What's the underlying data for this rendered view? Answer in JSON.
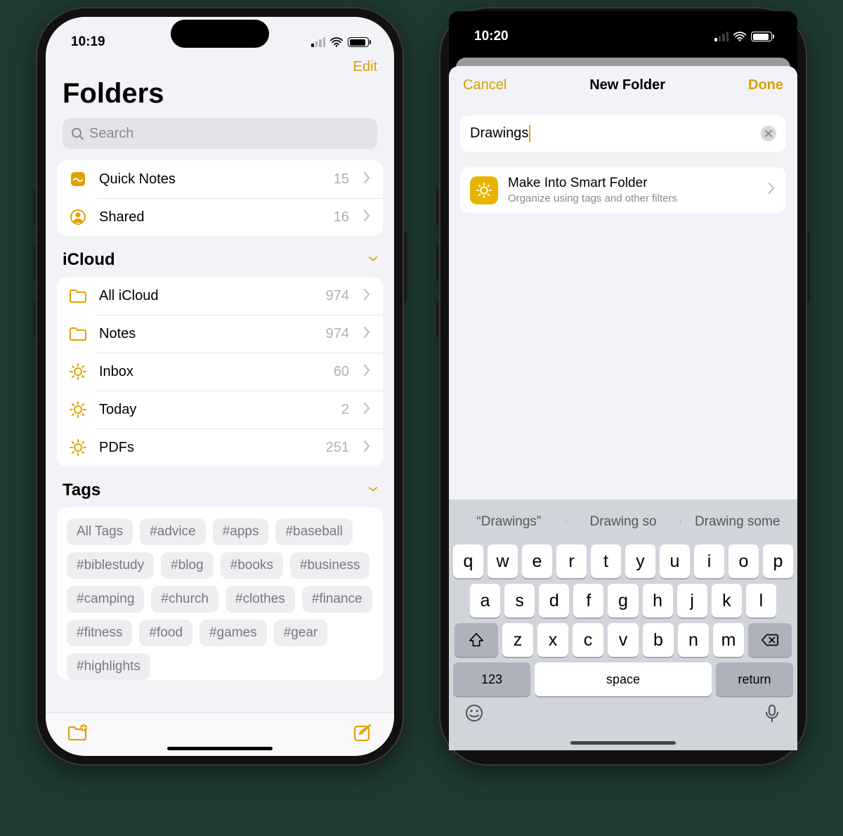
{
  "left": {
    "status": {
      "time": "10:19"
    },
    "nav": {
      "edit": "Edit",
      "title": "Folders"
    },
    "search": {
      "placeholder": "Search"
    },
    "top_group": [
      {
        "icon": "quicknote",
        "label": "Quick Notes",
        "count": "15"
      },
      {
        "icon": "shared",
        "label": "Shared",
        "count": "16"
      }
    ],
    "icloud": {
      "header": "iCloud",
      "items": [
        {
          "icon": "folder",
          "label": "All iCloud",
          "count": "974"
        },
        {
          "icon": "folder",
          "label": "Notes",
          "count": "974"
        },
        {
          "icon": "gear",
          "label": "Inbox",
          "count": "60"
        },
        {
          "icon": "gear",
          "label": "Today",
          "count": "2"
        },
        {
          "icon": "gear",
          "label": "PDFs",
          "count": "251"
        }
      ]
    },
    "tags": {
      "header": "Tags",
      "items": [
        "All Tags",
        "#advice",
        "#apps",
        "#baseball",
        "#biblestudy",
        "#blog",
        "#books",
        "#business",
        "#camping",
        "#church",
        "#clothes",
        "#finance",
        "#fitness",
        "#food",
        "#games",
        "#gear",
        "#highlights"
      ]
    }
  },
  "right": {
    "status": {
      "time": "10:20"
    },
    "sheet": {
      "cancel": "Cancel",
      "title": "New Folder",
      "done": "Done",
      "input": "Drawings",
      "smart": {
        "title": "Make Into Smart Folder",
        "subtitle": "Organize using tags and other filters"
      }
    },
    "keyboard": {
      "suggestions": [
        "“Drawings”",
        "Drawing so",
        "Drawing some"
      ],
      "row1": [
        "q",
        "w",
        "e",
        "r",
        "t",
        "y",
        "u",
        "i",
        "o",
        "p"
      ],
      "row2": [
        "a",
        "s",
        "d",
        "f",
        "g",
        "h",
        "j",
        "k",
        "l"
      ],
      "row3": [
        "z",
        "x",
        "c",
        "v",
        "b",
        "n",
        "m"
      ],
      "num": "123",
      "space": "space",
      "return": "return"
    }
  }
}
